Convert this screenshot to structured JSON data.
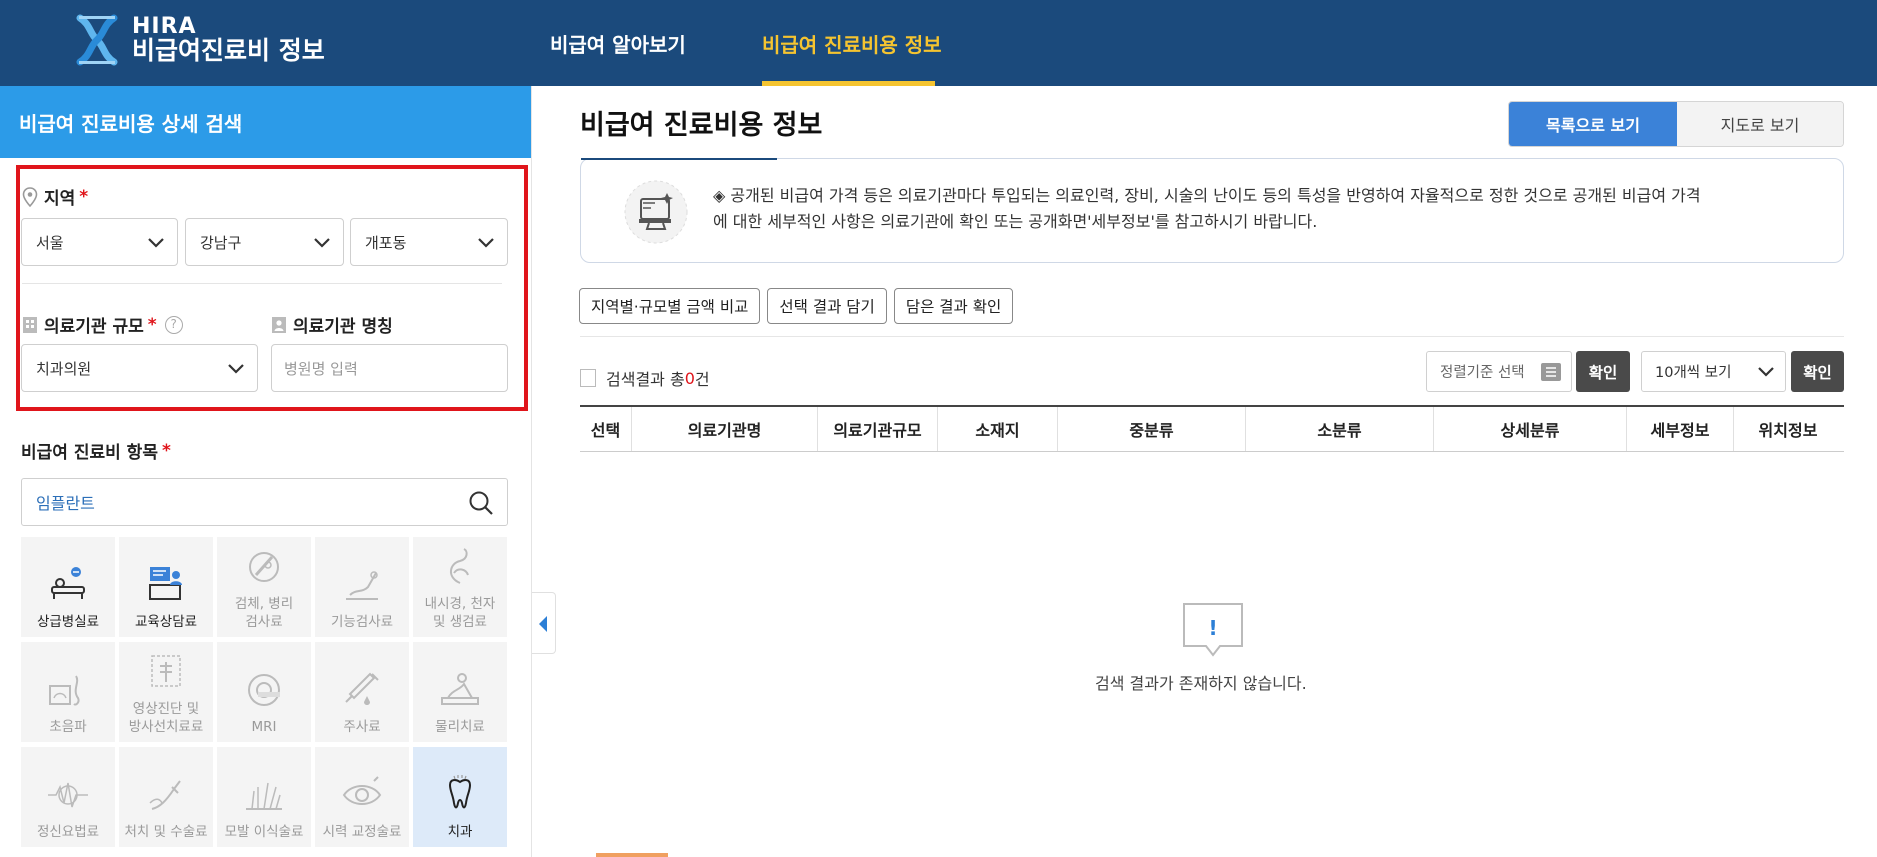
{
  "header": {
    "logo_line1": "HIRA",
    "logo_line2": "비급여진료비 정보",
    "nav": [
      {
        "label": "비급여 알아보기",
        "active": false
      },
      {
        "label": "비급여 진료비용 정보",
        "active": true
      }
    ],
    "bg_color": "#1b4a7c",
    "active_color": "#f5c430"
  },
  "sidebar": {
    "title": "비급여 진료비용 상세 검색",
    "region": {
      "label": "지역",
      "required": "*",
      "city": "서울",
      "district": "강남구",
      "dong": "개포동"
    },
    "scale": {
      "label": "의료기관 규모",
      "required": "*",
      "help": "?",
      "value": "치과의원"
    },
    "name": {
      "label": "의료기관 명칭",
      "placeholder": "병원명 입력"
    },
    "items": {
      "label": "비급여 진료비 항목",
      "required": "*",
      "search_value": "임플란트"
    },
    "categories": [
      {
        "l1": "상급병실료",
        "l2": "",
        "icon": "bed-icon",
        "state": "active"
      },
      {
        "l1": "교육상담료",
        "l2": "",
        "icon": "counsel-icon",
        "state": "active"
      },
      {
        "l1": "검체, 병리",
        "l2": "검사료",
        "icon": "specimen-icon",
        "state": "dim"
      },
      {
        "l1": "기능검사료",
        "l2": "",
        "icon": "function-test-icon",
        "state": "dim"
      },
      {
        "l1": "내시경, 천자",
        "l2": "및 생검료",
        "icon": "endoscope-icon",
        "state": "dim"
      },
      {
        "l1": "초음파",
        "l2": "",
        "icon": "ultrasound-icon",
        "state": "dim"
      },
      {
        "l1": "영상진단 및",
        "l2": "방사선치료료",
        "icon": "xray-icon",
        "state": "dim"
      },
      {
        "l1": "MRI",
        "l2": "",
        "icon": "mri-icon",
        "state": "dim"
      },
      {
        "l1": "주사료",
        "l2": "",
        "icon": "injection-icon",
        "state": "dim"
      },
      {
        "l1": "물리치료",
        "l2": "",
        "icon": "physio-icon",
        "state": "dim"
      },
      {
        "l1": "정신요법료",
        "l2": "",
        "icon": "psych-icon",
        "state": "dim"
      },
      {
        "l1": "처치 및 수술료",
        "l2": "",
        "icon": "surgery-icon",
        "state": "dim"
      },
      {
        "l1": "모발 이식술료",
        "l2": "",
        "icon": "hair-icon",
        "state": "dim"
      },
      {
        "l1": "시력 교정술료",
        "l2": "",
        "icon": "eye-icon",
        "state": "dim"
      },
      {
        "l1": "치과",
        "l2": "",
        "icon": "tooth-icon",
        "state": "selected"
      }
    ]
  },
  "main": {
    "title": "비급여 진료비용 정보",
    "view_list": "목록으로 보기",
    "view_map": "지도로 보기",
    "notice_line1": "◈ 공개된 비급여 가격 등은 의료기관마다 투입되는 의료인력, 장비, 시술의 난이도 등의 특성을 반영하여 자율적으로 정한 것으로 공개된 비급여 가격",
    "notice_line2": "에 대한 세부적인 사항은 의료기관에 확인 또는 공개화면'세부정보'를 참고하시기 바랍니다.",
    "buttons": [
      "지역별·규모별 금액 비교",
      "선택 결과 담기",
      "담은 결과 확인"
    ],
    "result_prefix": "검색결과 총",
    "result_count": "0",
    "result_suffix": "건",
    "sort_placeholder": "정렬기준 선택",
    "confirm": "확인",
    "page_size": "10개씩 보기",
    "columns": [
      "선택",
      "의료기관명",
      "의료기관규모",
      "소재지",
      "중분류",
      "소분류",
      "상세분류",
      "세부정보",
      "위치정보"
    ],
    "empty_message": "검색 결과가 존재하지 않습니다.",
    "empty_mark": "!"
  }
}
